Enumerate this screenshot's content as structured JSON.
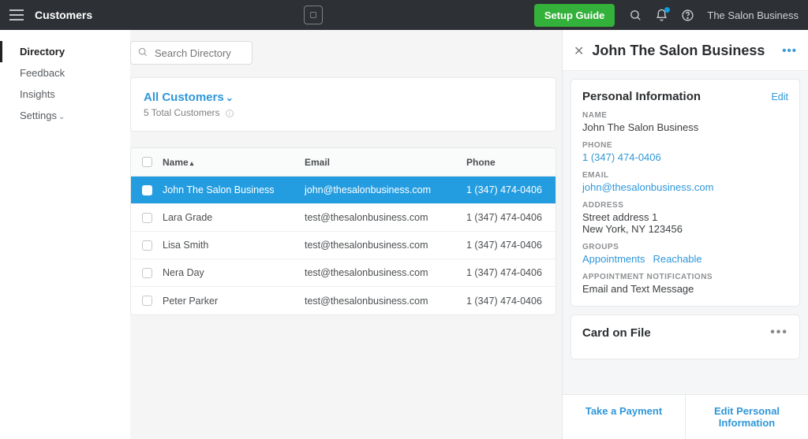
{
  "header": {
    "title": "Customers",
    "setup_button": "Setup Guide",
    "account_name": "The Salon Business"
  },
  "sidebar": {
    "items": [
      {
        "label": "Directory",
        "active": true
      },
      {
        "label": "Feedback"
      },
      {
        "label": "Insights"
      },
      {
        "label": "Settings",
        "chevron": true
      }
    ]
  },
  "search": {
    "placeholder": "Search Directory"
  },
  "group_panel": {
    "title": "All Customers",
    "subtitle": "5 Total Customers"
  },
  "table": {
    "columns": {
      "name": "Name",
      "email": "Email",
      "phone": "Phone"
    },
    "rows": [
      {
        "name": "John The Salon Business",
        "email": "john@thesalonbusiness.com",
        "phone": "1 (347) 474-0406",
        "selected": true
      },
      {
        "name": "Lara Grade",
        "email": "test@thesalonbusiness.com",
        "phone": "1 (347) 474-0406"
      },
      {
        "name": "Lisa Smith",
        "email": "test@thesalonbusiness.com",
        "phone": "1 (347) 474-0406"
      },
      {
        "name": "Nera Day",
        "email": "test@thesalonbusiness.com",
        "phone": "1 (347) 474-0406"
      },
      {
        "name": "Peter Parker",
        "email": "test@thesalonbusiness.com",
        "phone": "1 (347) 474-0406"
      }
    ]
  },
  "detail": {
    "title": "John The Salon Business",
    "personal": {
      "section_title": "Personal Information",
      "edit": "Edit",
      "labels": {
        "name": "NAME",
        "phone": "PHONE",
        "email": "EMAIL",
        "address": "ADDRESS",
        "groups": "GROUPS",
        "notifications": "APPOINTMENT NOTIFICATIONS"
      },
      "name": "John The Salon Business",
      "phone": "1 (347) 474-0406",
      "email": "john@thesalonbusiness.com",
      "address_line1": "Street address 1",
      "address_line2": "New York, NY 123456",
      "groups": [
        "Appointments",
        "Reachable"
      ],
      "notifications": "Email and Text Message"
    },
    "card_on_file": {
      "title": "Card on File"
    },
    "actions": {
      "take_payment": "Take a Payment",
      "edit_info": "Edit Personal Information"
    }
  }
}
